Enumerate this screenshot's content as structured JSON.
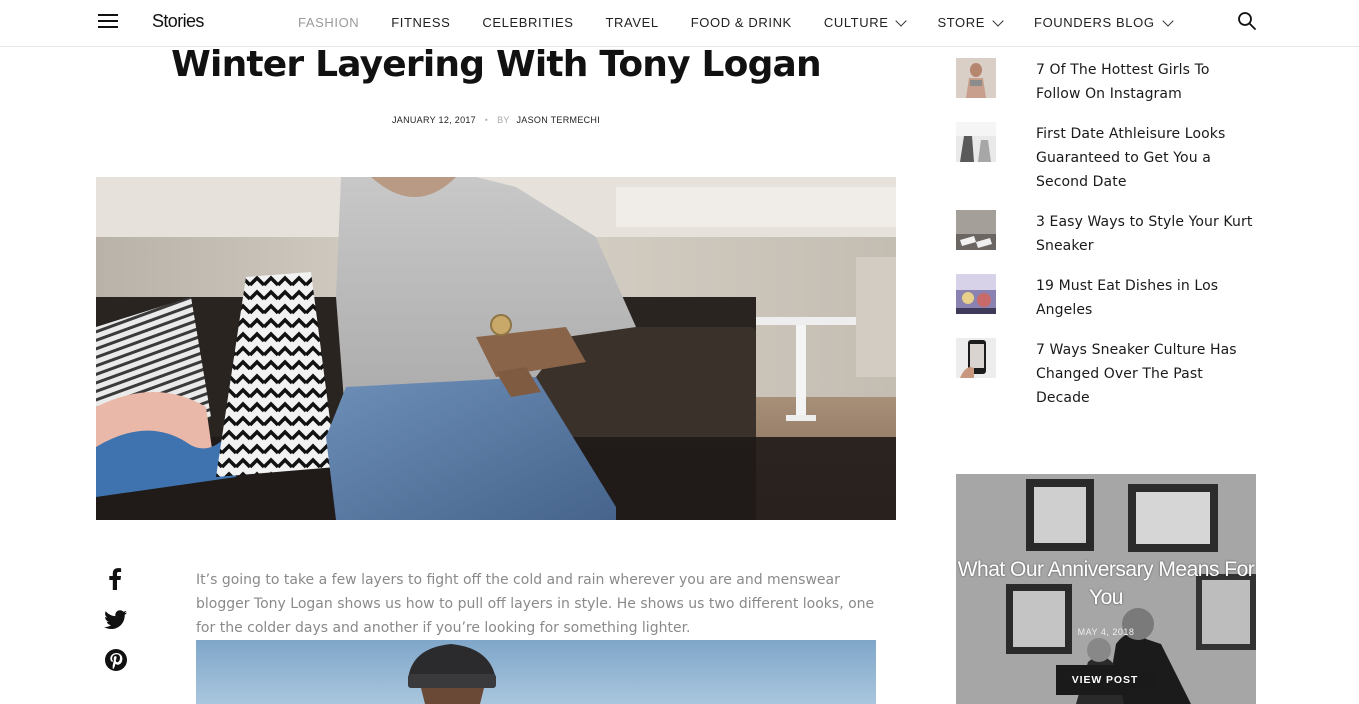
{
  "header": {
    "logo": "Stories",
    "nav": [
      {
        "label": "FASHION",
        "active": true
      },
      {
        "label": "FITNESS"
      },
      {
        "label": "CELEBRITIES"
      },
      {
        "label": "TRAVEL"
      },
      {
        "label": "FOOD & DRINK"
      },
      {
        "label": "CULTURE",
        "dropdown": true
      },
      {
        "label": "STORE",
        "dropdown": true
      },
      {
        "label": "FOUNDERS BLOG",
        "dropdown": true
      }
    ],
    "icons": {
      "menu": "hamburger-icon",
      "search": "search-icon"
    }
  },
  "article": {
    "title": "Winter Layering With Tony Logan",
    "date": "JANUARY 12, 2017",
    "separator": "•",
    "by_label": "BY",
    "author": "JASON TERMECHI",
    "intro": "It’s going to take a few layers to fight off the cold and rain wherever you are and menswear blogger Tony Logan shows us how to pull off layers in style. He shows us two different looks, one for the colder days and another if you’re looking for something lighter.",
    "share_icons": [
      "facebook-icon",
      "twitter-icon",
      "pinterest-icon"
    ]
  },
  "sidebar": {
    "posts": [
      {
        "title": "7 Of The Hottest Girls To Follow On Instagram"
      },
      {
        "title": "First Date Athleisure Looks Guaranteed to Get You a Second Date"
      },
      {
        "title": "3 Easy Ways to Style Your Kurt Sneaker"
      },
      {
        "title": "19 Must Eat Dishes in Los Angeles"
      },
      {
        "title": "7 Ways Sneaker Culture Has Changed Over The Past Decade"
      }
    ],
    "promo": {
      "title": "What Our Anniversary Means For You",
      "date": "MAY 4, 2018",
      "button": "VIEW POST"
    }
  },
  "colors": {
    "text": "#111111",
    "muted": "#8a8a8a",
    "nav_active": "#9a9a9a",
    "button_bg": "#1a1a1a",
    "divider": "#e6e6e6"
  }
}
